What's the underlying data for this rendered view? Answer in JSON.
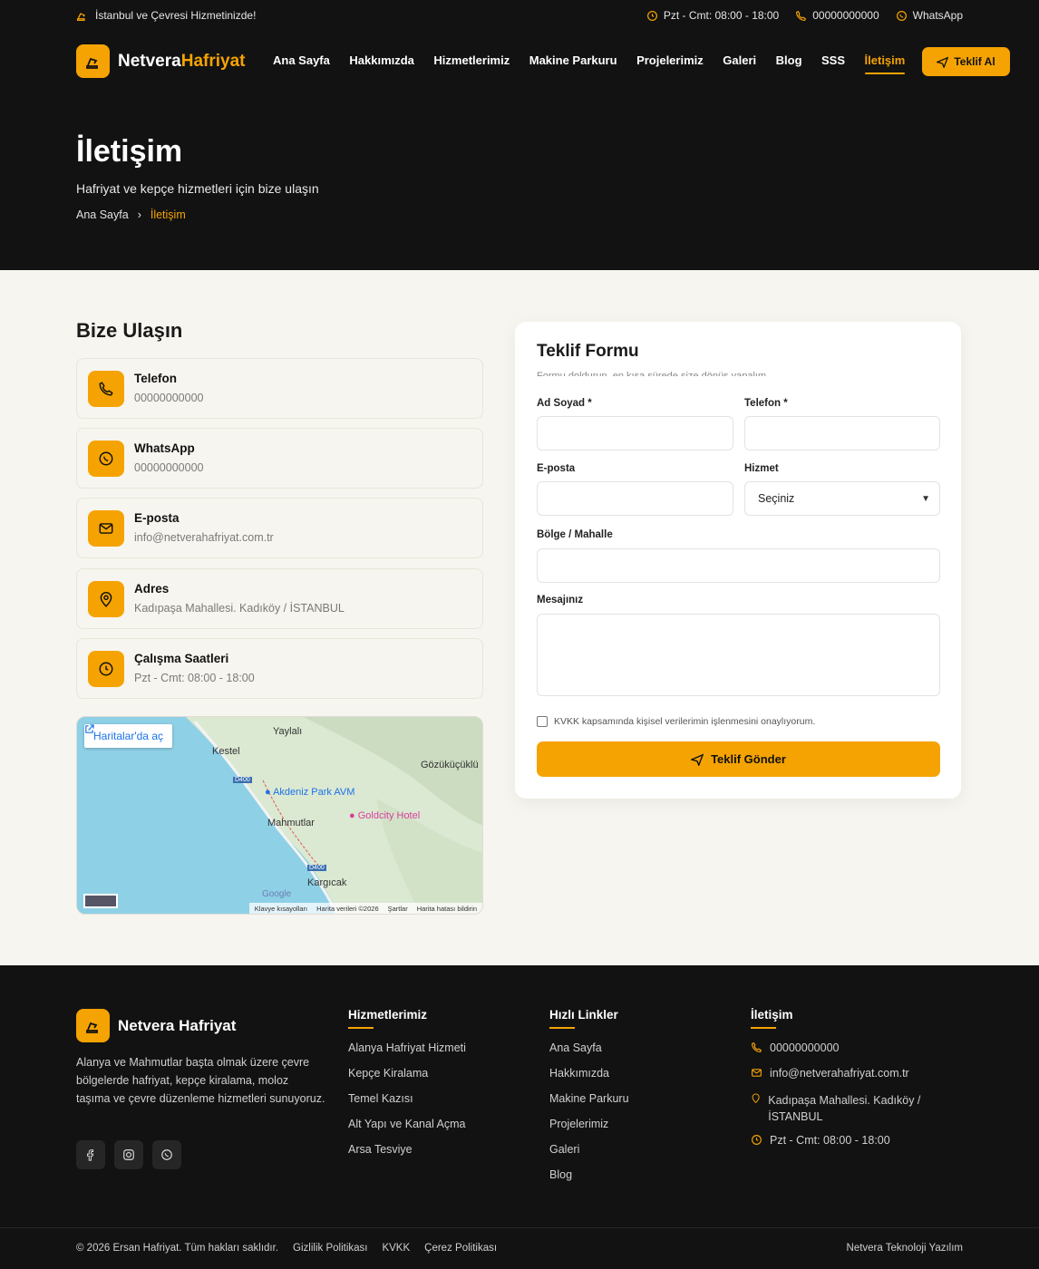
{
  "topbar": {
    "tagline": "İstanbul ve Çevresi Hizmetinizde!",
    "hours": "Pzt - Cmt: 08:00 - 18:00",
    "phone": "00000000000",
    "whatsapp": "WhatsApp"
  },
  "brand": {
    "name_part1": "Netvera",
    "name_part2": "Hafriyat",
    "accent": "#f5a302"
  },
  "nav": {
    "items": [
      "Ana Sayfa",
      "Hakkımızda",
      "Hizmetlerimiz",
      "Makine Parkuru",
      "Projelerimiz",
      "Galeri",
      "Blog",
      "SSS",
      "İletişim"
    ],
    "active": "İletişim",
    "cta": "Teklif Al"
  },
  "hero": {
    "title": "İletişim",
    "subtitle": "Hafriyat ve kepçe hizmetleri için bize ulaşın",
    "breadcrumb": [
      "Ana Sayfa",
      "İletişim"
    ]
  },
  "contact": {
    "title": "Bize Ulaşın",
    "cards": [
      {
        "icon": "phone-icon",
        "title": "Telefon",
        "value": "00000000000"
      },
      {
        "icon": "whatsapp-icon",
        "title": "WhatsApp",
        "value": "00000000000"
      },
      {
        "icon": "mail-icon",
        "title": "E-posta",
        "value": "info@netverahafriyat.com.tr"
      },
      {
        "icon": "location-icon",
        "title": "Adres",
        "value": "Kadıpaşa Mahallesi. Kadıköy / İSTANBUL"
      },
      {
        "icon": "clock-icon",
        "title": "Çalışma Saatleri",
        "value": "Pzt - Cmt: 08:00 - 18:00"
      }
    ]
  },
  "map": {
    "open_label": "Haritalar'da aç",
    "places": [
      "Yaylalı",
      "Kestel",
      "Gözüküçüklü",
      "Akdeniz Park AVM",
      "Goldcity Hotel",
      "Mahmutlar",
      "Kargıcak"
    ],
    "roads": [
      "D400",
      "D400"
    ],
    "google": "Google",
    "footer": [
      "Klavye kısayolları",
      "Harita verileri ©2026",
      "Şartlar",
      "Harita hatası bildirin"
    ]
  },
  "form": {
    "title": "Teklif Formu",
    "subtitle": "Formu doldurun, en kısa sürede size dönüş yapalım.",
    "labels": {
      "name": "Ad Soyad *",
      "phone": "Telefon *",
      "email": "E-posta",
      "service": "Hizmet",
      "region": "Bölge / Mahalle",
      "message": "Mesajınız"
    },
    "service_selected": "Seçiniz",
    "consent": "KVKK kapsamında kişisel verilerimin işlenmesini onaylıyorum.",
    "submit": "Teklif Gönder"
  },
  "footer": {
    "brand": "Netvera Hafriyat",
    "description": "Alanya ve Mahmutlar başta olmak üzere çevre bölgelerde hafriyat, kepçe kiralama, moloz taşıma ve çevre düzenleme hizmetleri sunuyoruz.",
    "services_title": "Hizmetlerimiz",
    "services": [
      "Alanya Hafriyat Hizmeti",
      "Kepçe Kiralama",
      "Temel Kazısı",
      "Alt Yapı ve Kanal Açma",
      "Arsa Tesviye"
    ],
    "links_title": "Hızlı Linkler",
    "links": [
      "Ana Sayfa",
      "Hakkımızda",
      "Makine Parkuru",
      "Projelerimiz",
      "Galeri",
      "Blog"
    ],
    "contact_title": "İletişim",
    "contact": {
      "phone": "00000000000",
      "email": "info@netverahafriyat.com.tr",
      "address": "Kadıpaşa Mahallesi. Kadıköy / İSTANBUL",
      "hours": "Pzt - Cmt: 08:00 - 18:00"
    },
    "copyright": "© 2026 Ersan Hafriyat. Tüm hakları saklıdır.",
    "legal": [
      "Gizlilik Politikası",
      "KVKK",
      "Çerez Politikası"
    ],
    "credit": "Netvera Teknoloji Yazılım"
  }
}
